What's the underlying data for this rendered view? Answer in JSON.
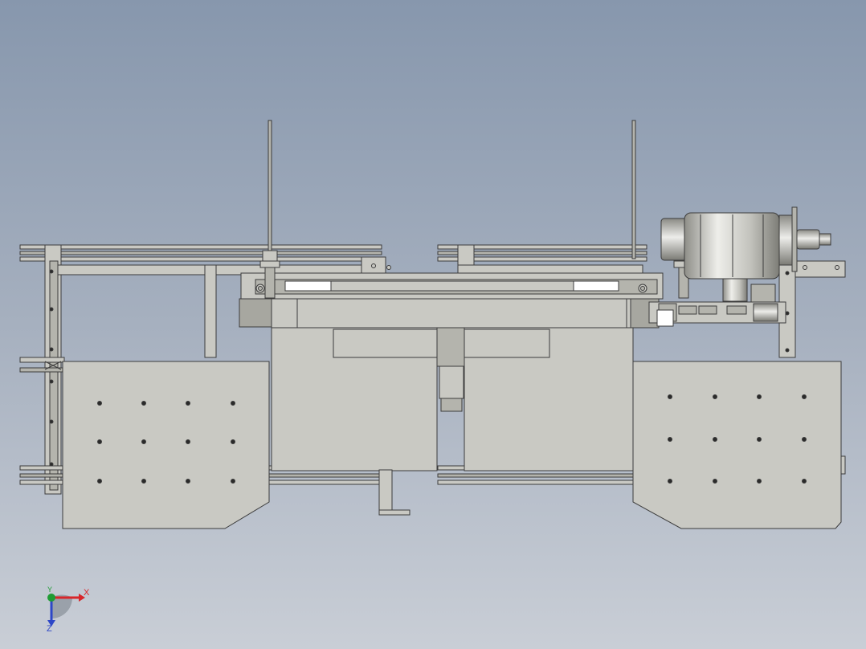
{
  "viewport": {
    "background_top": "#8797ad",
    "background_bottom": "#c9ced6"
  },
  "model": {
    "part_fill": "#c9c9c3",
    "part_fill_dark": "#b4b4ad",
    "edge_color": "#3c3c3c",
    "motor_fill": "#c6c6c0",
    "hole_color": "#2a2a2a"
  },
  "triad": {
    "x_label": "X",
    "y_label": "Y",
    "z_label": "Z",
    "x_color": "#d8262a",
    "y_color": "#1f9c34",
    "z_color": "#2d47c7"
  }
}
